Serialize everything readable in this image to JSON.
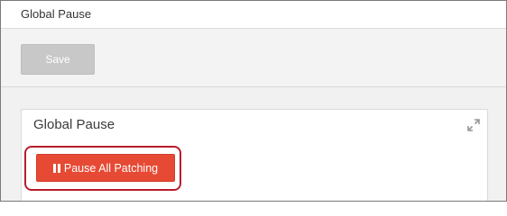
{
  "header": {
    "title": "Global Pause"
  },
  "toolbar": {
    "save_label": "Save"
  },
  "panel": {
    "title": "Global Pause",
    "expand_icon": "expand-icon",
    "pause_button_label": "Pause All Patching",
    "pause_icon": "pause-icon"
  },
  "colors": {
    "pause_button": "#e64a34",
    "highlight_outline": "#b81c2b",
    "save_button_disabled": "#c8c8c8"
  }
}
